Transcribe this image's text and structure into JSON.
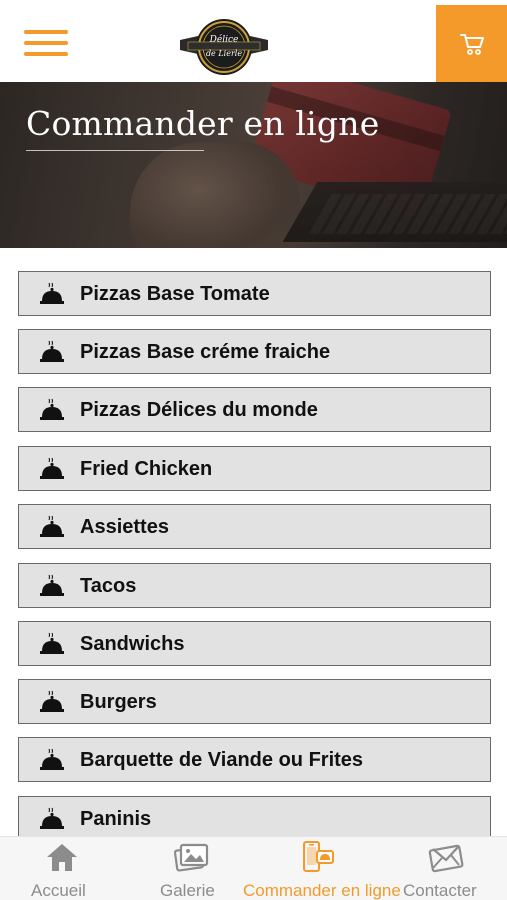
{
  "header": {
    "logo_text_line1": "Délice",
    "logo_text_line2": "de Lierle",
    "colors": {
      "accent": "#f39a2b"
    }
  },
  "hero": {
    "title": "Commander en ligne"
  },
  "menu": {
    "items": [
      {
        "label": "Pizzas Base Tomate"
      },
      {
        "label": "Pizzas Base créme fraiche"
      },
      {
        "label": "Pizzas Délices du monde"
      },
      {
        "label": "Fried Chicken"
      },
      {
        "label": "Assiettes"
      },
      {
        "label": "Tacos"
      },
      {
        "label": "Sandwichs"
      },
      {
        "label": "Burgers"
      },
      {
        "label": "Barquette de Viande ou Frites"
      },
      {
        "label": "Paninis"
      }
    ],
    "item_icon": "cloche-icon"
  },
  "bottom_nav": {
    "items": [
      {
        "label": "Accueil",
        "icon": "home-icon",
        "active": false
      },
      {
        "label": "Galerie",
        "icon": "gallery-icon",
        "active": false
      },
      {
        "label": "Commander en ligne",
        "icon": "order-online-icon",
        "active": true
      },
      {
        "label": "Contacter",
        "icon": "mail-icon",
        "active": false
      }
    ]
  }
}
